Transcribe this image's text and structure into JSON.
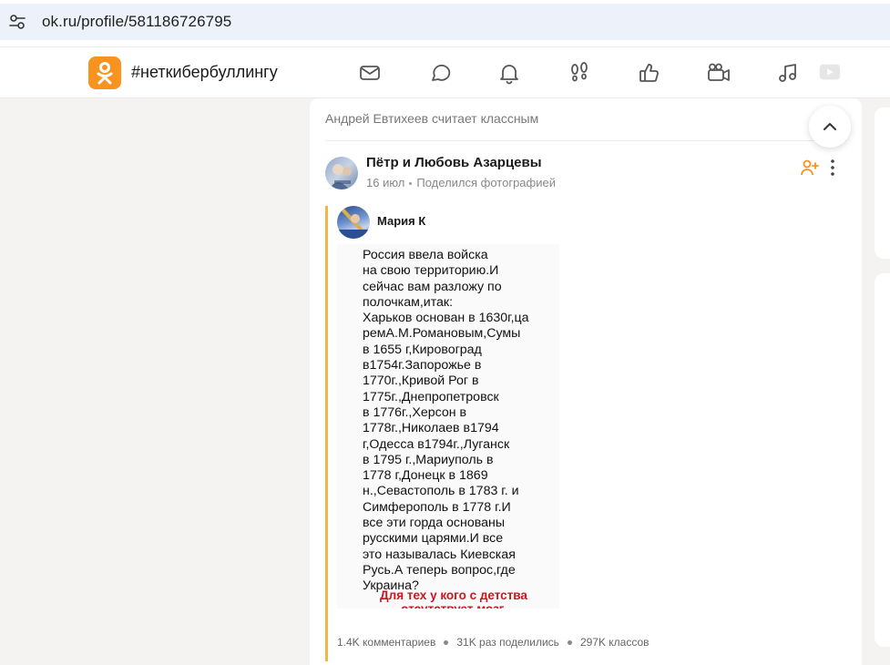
{
  "browser": {
    "url": "ok.ru/profile/581186726795"
  },
  "header": {
    "hashtag": "#неткибербуллингу",
    "nav_icons": [
      "mail-icon",
      "chat-icon",
      "bell-icon",
      "footprints-icon",
      "like-icon",
      "video-camera-icon",
      "music-icon",
      "video-play-icon"
    ]
  },
  "feed": {
    "liked_by": "Андрей Евтихеев считает классным",
    "post": {
      "author": "Пётр и Любовь Азарцевы",
      "date": "16 июл",
      "action": "Поделился фотографией",
      "quoted_author": "Мария К",
      "photo_text": "Россия ввела войска\nна свою территорию.И\nсейчас вам разложу по\nполочкам,итак:\nХарьков основан в 1630г,ца\nремА.М.Романовым,Сумы\nв 1655 г,Кировоград\nв1754г.Запорожье в\n1770г.,Кривой Рог в\n1775г.,Днепропетровск\nв 1776г.,Херсон в\n1778г.,Николаев в1794\nг,Одесса в1794г.,Луганск\nв 1795 г.,Мариуполь в\n1778 г,Донецк в 1869\nн.,Севастополь в 1783 г. и\nСимферополь в 1778 г.И\nвсе эти горда основаны\nрусскими царями.И все\nэто называлась Киевская\nРусь.А теперь вопрос,где\nУкраина?",
      "photo_caption_red": "Для тех у кого с детства\nотсутствует мозг.",
      "stats": {
        "comments": "1.4K комментариев",
        "shares": "31K раз поделились",
        "likes": "297K классов"
      }
    }
  },
  "colors": {
    "ok_orange": "#f7931e",
    "quote_bar": "#f7b24a",
    "caption_red": "#d0131d",
    "url_bg": "#edf2fa"
  }
}
